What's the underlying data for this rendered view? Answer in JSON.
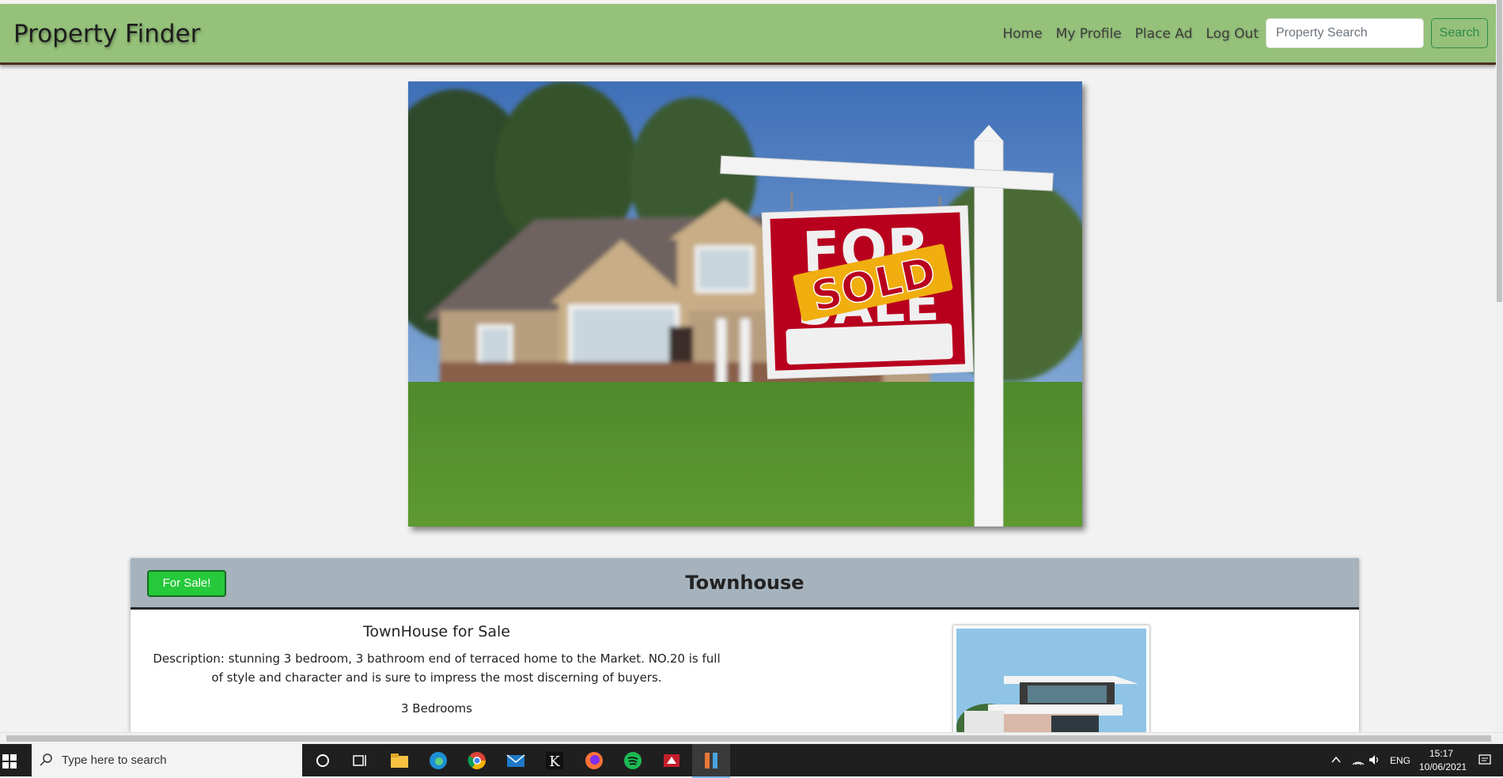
{
  "brand": "Property Finder",
  "nav": {
    "home": "Home",
    "profile": "My Profile",
    "place_ad": "Place Ad",
    "logout": "Log Out",
    "search_placeholder": "Property Search",
    "search_button": "Search"
  },
  "hero": {
    "sign_top": "FOR",
    "sign_bottom": "SALE",
    "sold_label": "SOLD"
  },
  "listing": {
    "badge": "For Sale!",
    "type": "Townhouse",
    "heading": "TownHouse for Sale",
    "description": "Description: stunning 3 bedroom, 3 bathroom end of terraced home to the Market. NO.20 is full of style and character and is sure to impress the most discerning of buyers.",
    "bedrooms": "3 Bedrooms"
  },
  "taskbar": {
    "search_placeholder": "Type here to search",
    "language": "ENG",
    "time": "15:17",
    "date": "10/06/2021"
  },
  "colors": {
    "navbar": "#95c17a",
    "card_header": "#a6b3bd",
    "sale_badge": "#26c93a",
    "search_button": "#2f8a48"
  }
}
